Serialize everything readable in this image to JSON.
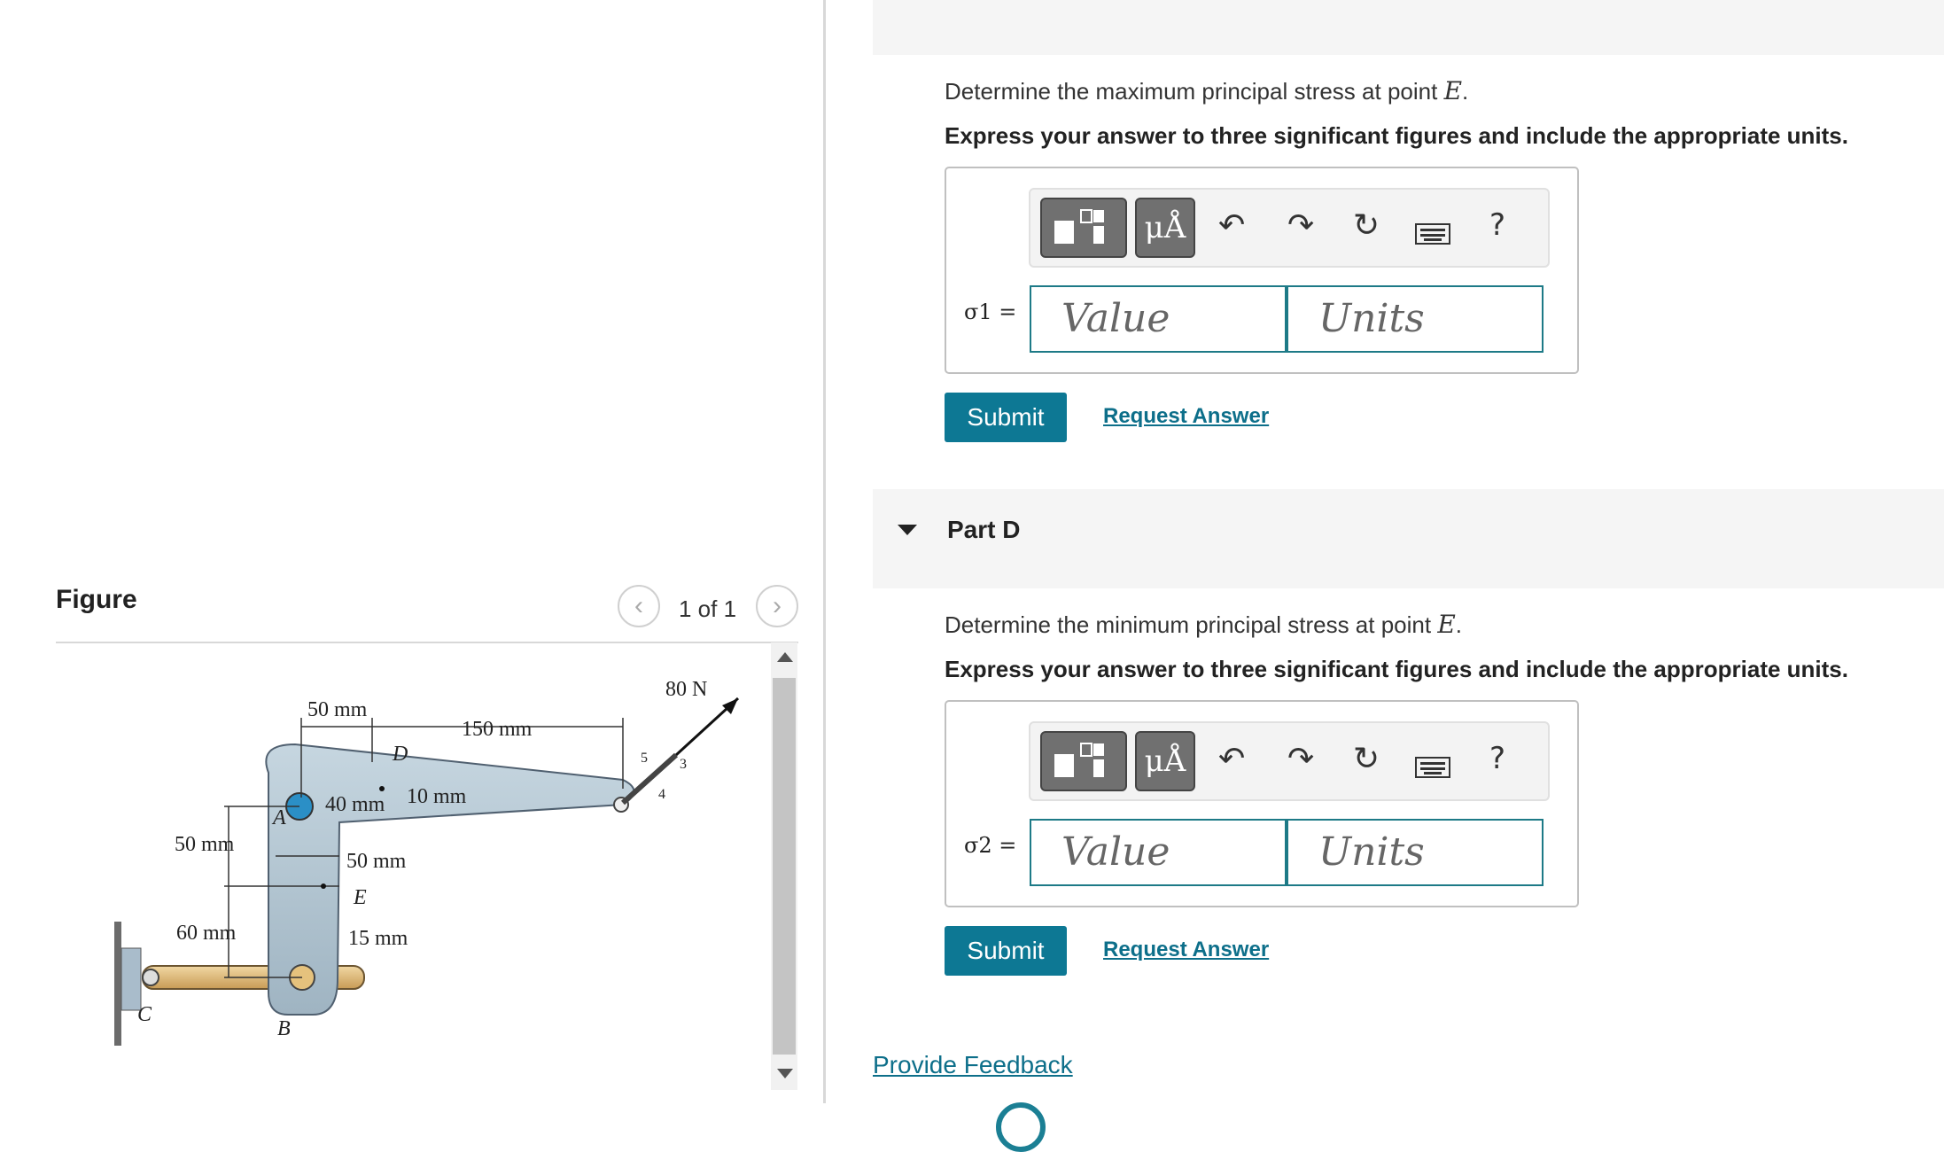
{
  "figure_panel": {
    "title": "Figure",
    "pager": "1 of 1",
    "prev_icon": "chevron-left-icon",
    "next_icon": "chevron-right-icon",
    "labels": {
      "force": "80 N",
      "dim_50_top": "50 mm",
      "dim_150": "150 mm",
      "point_d": "D",
      "dim_40": "40 mm",
      "dim_10": "10 mm",
      "point_a": "A",
      "dim_50_left": "50 mm",
      "dim_50_mid": "50 mm",
      "point_e": "E",
      "dim_60": "60 mm",
      "dim_15": "15 mm",
      "point_c": "C",
      "point_b": "B",
      "slope_5": "5",
      "slope_3": "3",
      "slope_4": "4"
    }
  },
  "parts": {
    "part_c": {
      "question_prefix": "Determine the maximum principal stress at point",
      "point": "E",
      "instruction": "Express your answer to three significant figures and include the appropriate units.",
      "sigma_label": "σ1 =",
      "value_placeholder": "Value",
      "units_placeholder": "Units",
      "submit_label": "Submit",
      "request_label": "Request Answer"
    },
    "part_d": {
      "title": "Part D",
      "question_prefix": "Determine the minimum principal stress at point",
      "point": "E",
      "instruction": "Express your answer to three significant figures and include the appropriate units.",
      "sigma_label": "σ2 =",
      "value_placeholder": "Value",
      "units_placeholder": "Units",
      "submit_label": "Submit",
      "request_label": "Request Answer"
    }
  },
  "toolbar": {
    "unit_button": "μÅ",
    "help": "?",
    "icons": [
      "templates-icon",
      "units-icon",
      "undo-icon",
      "redo-icon",
      "reset-icon",
      "keyboard-icon",
      "help-icon"
    ]
  },
  "feedback": {
    "label": "Provide Feedback"
  },
  "colors": {
    "accent": "#0d7894",
    "link": "#0d6f8a",
    "field_border": "#1d7a87"
  }
}
